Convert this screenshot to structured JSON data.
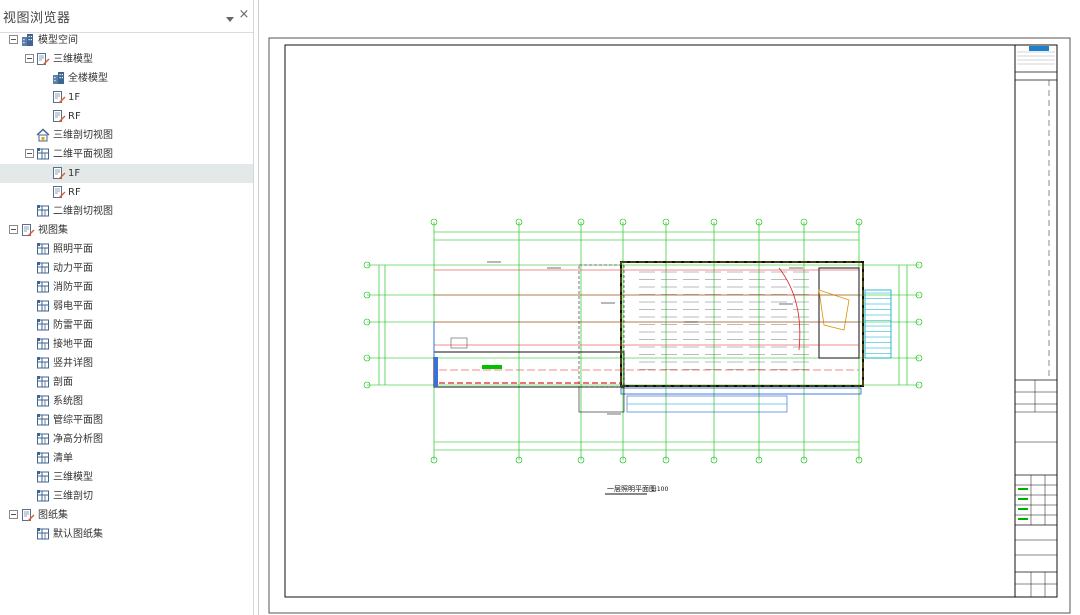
{
  "panel": {
    "title": "视图浏览器",
    "pin_icon": "dropdown-pin-icon",
    "close_icon": "close-icon"
  },
  "tree": [
    {
      "label": "模型空间",
      "icon": "building-icon",
      "level": 0,
      "expanded": true
    },
    {
      "label": "三维模型",
      "icon": "doc-edit-icon",
      "level": 1,
      "expanded": true
    },
    {
      "label": "全楼模型",
      "icon": "building-icon",
      "level": 2
    },
    {
      "label": "1F",
      "icon": "doc-edit-icon",
      "level": 2
    },
    {
      "label": "RF",
      "icon": "doc-edit-icon",
      "level": 2
    },
    {
      "label": "三维剖切视图",
      "icon": "house-icon",
      "level": 1
    },
    {
      "label": "二维平面视图",
      "icon": "plan-icon",
      "level": 1,
      "expanded": true
    },
    {
      "label": "1F",
      "icon": "doc-edit-icon",
      "level": 2,
      "selected": true
    },
    {
      "label": "RF",
      "icon": "doc-edit-icon",
      "level": 2
    },
    {
      "label": "二维剖切视图",
      "icon": "plan-icon",
      "level": 1
    },
    {
      "label": "视图集",
      "icon": "doc-edit-icon",
      "level": 0,
      "expanded": true
    },
    {
      "label": "照明平面",
      "icon": "plan-icon",
      "level": 1
    },
    {
      "label": "动力平面",
      "icon": "plan-icon",
      "level": 1
    },
    {
      "label": "消防平面",
      "icon": "plan-icon",
      "level": 1
    },
    {
      "label": "弱电平面",
      "icon": "plan-icon",
      "level": 1
    },
    {
      "label": "防雷平面",
      "icon": "plan-icon",
      "level": 1
    },
    {
      "label": "接地平面",
      "icon": "plan-icon",
      "level": 1
    },
    {
      "label": "竖井详图",
      "icon": "plan-icon",
      "level": 1
    },
    {
      "label": "剖面",
      "icon": "plan-icon",
      "level": 1
    },
    {
      "label": "系统图",
      "icon": "plan-icon",
      "level": 1
    },
    {
      "label": "管综平面图",
      "icon": "plan-icon",
      "level": 1
    },
    {
      "label": "净高分析图",
      "icon": "plan-icon",
      "level": 1
    },
    {
      "label": "清单",
      "icon": "plan-icon",
      "level": 1
    },
    {
      "label": "三维模型",
      "icon": "plan-icon",
      "level": 1
    },
    {
      "label": "三维剖切",
      "icon": "plan-icon",
      "level": 1
    },
    {
      "label": "图纸集",
      "icon": "doc-edit-icon",
      "level": 0,
      "expanded": true
    },
    {
      "label": "默认图纸集",
      "icon": "plan-icon",
      "level": 1
    }
  ],
  "drawing": {
    "plan_title": "一层照明平面图",
    "plan_scale": "1:100"
  },
  "colors": {
    "selected_row": "#e3e9e9",
    "grid_green": "#00c000",
    "wall_red": "#e02020",
    "cable_blue": "#1e5bd8",
    "stair_cyan": "#00a8c8",
    "title_line": "#000000"
  }
}
